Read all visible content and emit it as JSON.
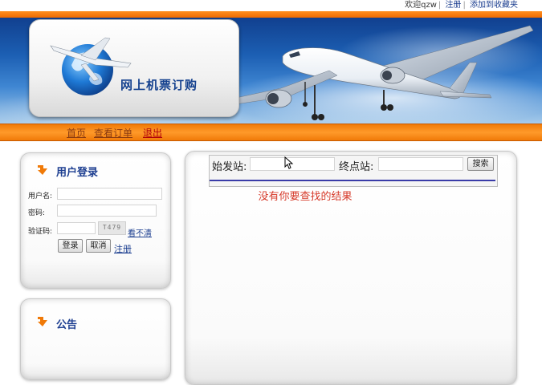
{
  "top_links": {
    "welcome": "欢迎qzw",
    "register": "注册",
    "bookmark": "添加到收藏夹"
  },
  "logo": {
    "title": "网上机票订购"
  },
  "nav": {
    "home": "首页",
    "orders": "查看订单",
    "logout": "退出"
  },
  "login": {
    "title": "用户登录",
    "username_label": "用户名:",
    "username_value": "",
    "password_label": "密码:",
    "password_value": "",
    "captcha_label": "验证码:",
    "captcha_value": "",
    "captcha_image_text": "T479",
    "refresh_captcha": "看不清",
    "login_button": "登录",
    "cancel_button": "取消",
    "register_link": "注册"
  },
  "notice": {
    "title": "公告"
  },
  "search": {
    "from_label": "始发站:",
    "from_value": "",
    "to_label": "终点站:",
    "to_value": "",
    "search_button": "搜索",
    "no_results": "没有你要查找的结果"
  },
  "colors": {
    "orange": "#f07a08",
    "brand_blue": "#1e3f91",
    "error_red": "#d63a2a"
  }
}
